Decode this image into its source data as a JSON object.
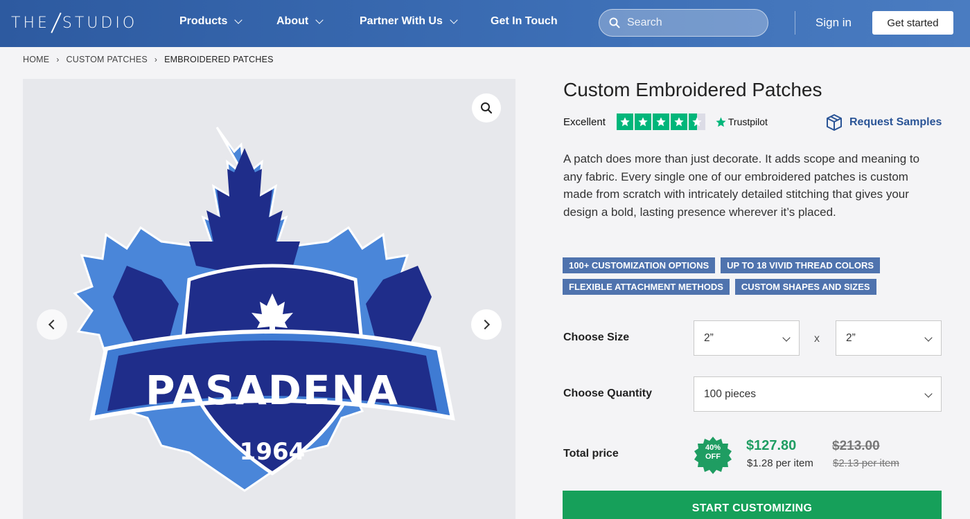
{
  "header": {
    "logo_left": "THE",
    "logo_right": "STUDIO",
    "nav": [
      {
        "label": "Products",
        "dropdown": true
      },
      {
        "label": "About",
        "dropdown": true
      },
      {
        "label": "Partner With Us",
        "dropdown": true
      },
      {
        "label": "Get In Touch",
        "dropdown": false
      }
    ],
    "search_placeholder": "Search",
    "signin": "Sign in",
    "get_started": "Get started"
  },
  "breadcrumb": [
    "HOME",
    "CUSTOM PATCHES",
    "EMBROIDERED PATCHES"
  ],
  "breadcrumb_sep": "›",
  "product": {
    "title": "Custom Embroidered Patches",
    "rating_label": "Excellent",
    "rating_stars": 4.5,
    "trustpilot": "Trustpilot",
    "request_samples": "Request Samples",
    "description": "A patch does more than just decorate. It adds scope and meaning to any fabric. Every single one of our embroidered patches is custom made from scratch with intricately detailed stitching that gives your design a bold, lasting presence wherever it’s placed.",
    "tags": [
      "100+ CUSTOMIZATION OPTIONS",
      "UP TO 18 VIVID THREAD COLORS",
      "FLEXIBLE ATTACHMENT METHODS",
      "CUSTOM SHAPES AND SIZES"
    ],
    "image_text": {
      "word": "PASADENA",
      "year": "1964"
    }
  },
  "options": {
    "size_label": "Choose Size",
    "size_w": "2”",
    "size_sep": "x",
    "size_h": "2”",
    "qty_label": "Choose Quantity",
    "qty": "100 pieces"
  },
  "pricing": {
    "label": "Total price",
    "discount_line1": "40%",
    "discount_line2": "OFF",
    "price": "$127.80",
    "per_item": "$1.28 per item",
    "old_price": "$213.00",
    "old_per_item": "$2.13 per item"
  },
  "cta": "START CUSTOMIZING",
  "colors": {
    "header": "#3d6fb6",
    "accent_green": "#16a05a",
    "tag_blue": "#4f73ae",
    "trustpilot_green": "#00b67a"
  }
}
